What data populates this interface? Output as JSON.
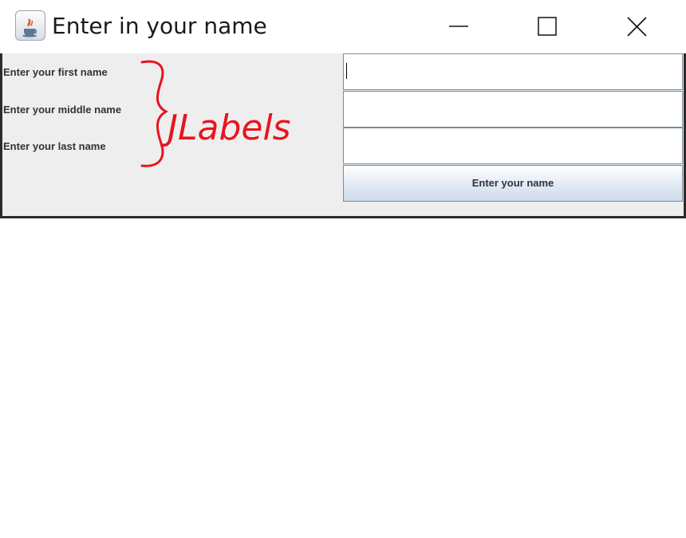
{
  "window": {
    "title": "Enter in your name",
    "app_icon": "java-coffee-cup-icon"
  },
  "controls": {
    "minimize_icon": "minimize-icon",
    "maximize_icon": "maximize-icon",
    "close_icon": "close-icon"
  },
  "form": {
    "labels": [
      "Enter your first name",
      "Enter your middle name",
      "Enter your last name"
    ],
    "fields": [
      {
        "value": "",
        "placeholder": ""
      },
      {
        "value": "",
        "placeholder": ""
      },
      {
        "value": "",
        "placeholder": ""
      }
    ],
    "button_label": "Enter your name"
  },
  "annotation": {
    "text": "JLabels",
    "color": "#e8141c",
    "shape": "curly-brace"
  },
  "colors": {
    "client_bg": "#eeeeee",
    "field_border": "#7a8a99"
  }
}
